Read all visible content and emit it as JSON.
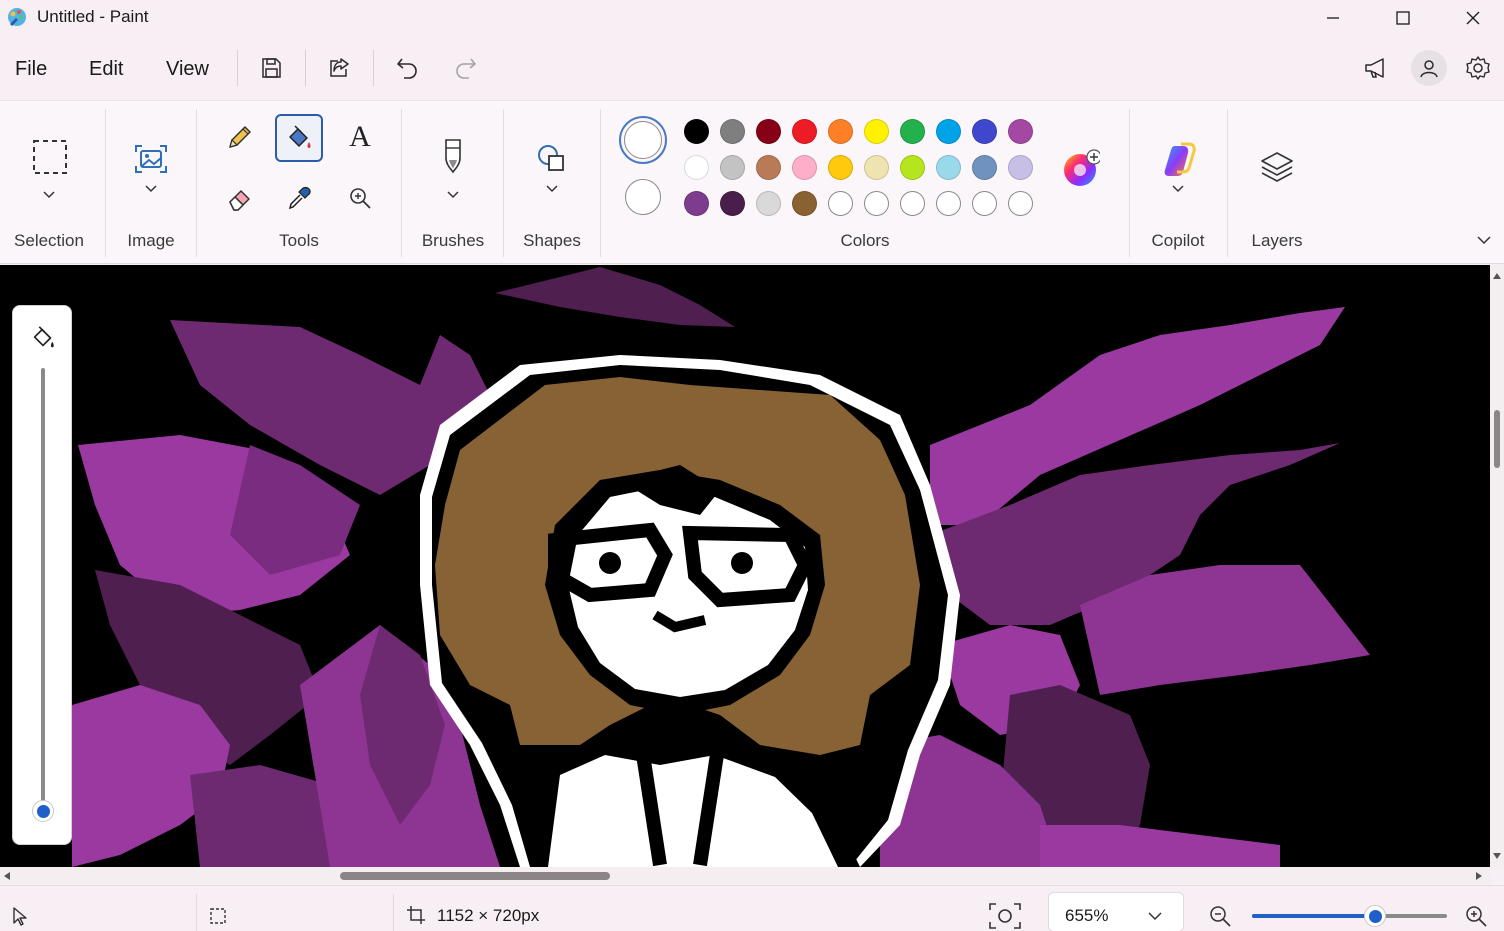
{
  "window": {
    "title": "Untitled - Paint",
    "controls": [
      "minimize",
      "maximize",
      "close"
    ]
  },
  "menubar": {
    "file_label": "File",
    "edit_label": "Edit",
    "view_label": "View",
    "icons": [
      "save-icon",
      "share-icon",
      "undo-icon",
      "redo-icon",
      "megaphone-icon",
      "account-icon",
      "settings-icon"
    ]
  },
  "ribbon": {
    "groups": {
      "selection": "Selection",
      "image": "Image",
      "tools": "Tools",
      "brushes": "Brushes",
      "shapes": "Shapes",
      "colors": "Colors",
      "copilot": "Copilot",
      "layers": "Layers"
    },
    "text_tool_glyph": "A",
    "active_tool": "fill",
    "palette_row1": [
      "#000000",
      "#7f7f7f",
      "#880015",
      "#ed1c24",
      "#ff7f27",
      "#fff200",
      "#22b14c",
      "#00a2e8",
      "#3f48cc",
      "#a349a4"
    ],
    "palette_row2": [
      "#ffffff",
      "#c3c3c3",
      "#b97a57",
      "#ffaec9",
      "#ffc90e",
      "#efe4b0",
      "#b5e61d",
      "#99d9ea",
      "#7092be",
      "#c8bfe7"
    ],
    "palette_row3": [
      "#7e3c8e",
      "#4a1e4a",
      "#d9d9d9",
      "#8a6232",
      "",
      "",
      "",
      "",
      "",
      ""
    ]
  },
  "status": {
    "canvas_size": "1152 × 720px",
    "zoom": "655%",
    "zoom_slider_level": 0.63
  }
}
